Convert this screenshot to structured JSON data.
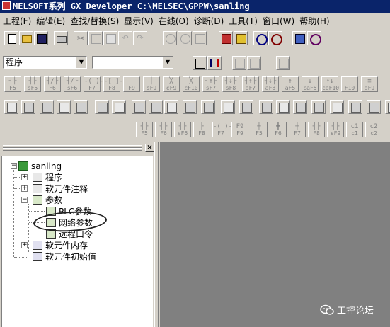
{
  "window": {
    "title": "MELSOFT系列 GX Developer C:\\MELSEC\\GPPW\\sanling"
  },
  "menu": [
    "工程(F)",
    "编辑(E)",
    "查找/替换(S)",
    "显示(V)",
    "在线(O)",
    "诊断(D)",
    "工具(T)",
    "窗口(W)",
    "帮助(H)"
  ],
  "toolbar2": {
    "combo1_value": "程序",
    "combo2_value": ""
  },
  "fkeys_row1": [
    {
      "sym": "┤├",
      "key": "F5"
    },
    {
      "sym": "┤├",
      "key": "sF5"
    },
    {
      "sym": "┤/├",
      "key": "F6"
    },
    {
      "sym": "┤/├",
      "key": "sF6"
    },
    {
      "sym": "-( )-",
      "key": "F7"
    },
    {
      "sym": "-[ ]-",
      "key": "F8"
    },
    {
      "sym": "—",
      "key": "F9"
    },
    {
      "sym": "│",
      "key": "sF9"
    },
    {
      "sym": "╳",
      "key": "cF9"
    },
    {
      "sym": "╳",
      "key": "cF10"
    },
    {
      "sym": "┤↑├",
      "key": "sF7"
    },
    {
      "sym": "┤↓├",
      "key": "sF8"
    },
    {
      "sym": "┤↑├",
      "key": "aF7"
    },
    {
      "sym": "┤↓├",
      "key": "aF8"
    },
    {
      "sym": "↑",
      "key": "aF5"
    },
    {
      "sym": "↓",
      "key": "caF5"
    },
    {
      "sym": "↑↓",
      "key": "caF10"
    },
    {
      "sym": "—",
      "key": "F10"
    },
    {
      "sym": "≡",
      "key": "aF9"
    }
  ],
  "fkeys_row3": [
    {
      "sym": "┤├",
      "key": "F5"
    },
    {
      "sym": "┤├",
      "key": "F6"
    },
    {
      "sym": "┤├",
      "key": "sF6"
    },
    {
      "sym": "├",
      "key": "F8"
    },
    {
      "sym": "-( )-",
      "key": "F7"
    },
    {
      "sym": "F9",
      "key": "F9"
    },
    {
      "sym": "┼",
      "key": "F5"
    },
    {
      "sym": "╋",
      "key": "F6"
    },
    {
      "sym": "┼",
      "key": "F7"
    },
    {
      "sym": "┤├",
      "key": "F8"
    },
    {
      "sym": "┤├",
      "key": "sF9"
    },
    {
      "sym": "c1",
      "key": "c1"
    },
    {
      "sym": "c2",
      "key": "c2"
    }
  ],
  "panel": {
    "close_label": "×"
  },
  "tree": {
    "root": "sanling",
    "program": "程序",
    "device_comment": "软元件注释",
    "parameter": "参数",
    "plc_param": "PLC参数",
    "network_param": "网络参数",
    "remote_password": "远程口令",
    "device_memory": "软元件内存",
    "device_init": "软元件初始值"
  },
  "watermark": {
    "text": "工控论坛"
  }
}
